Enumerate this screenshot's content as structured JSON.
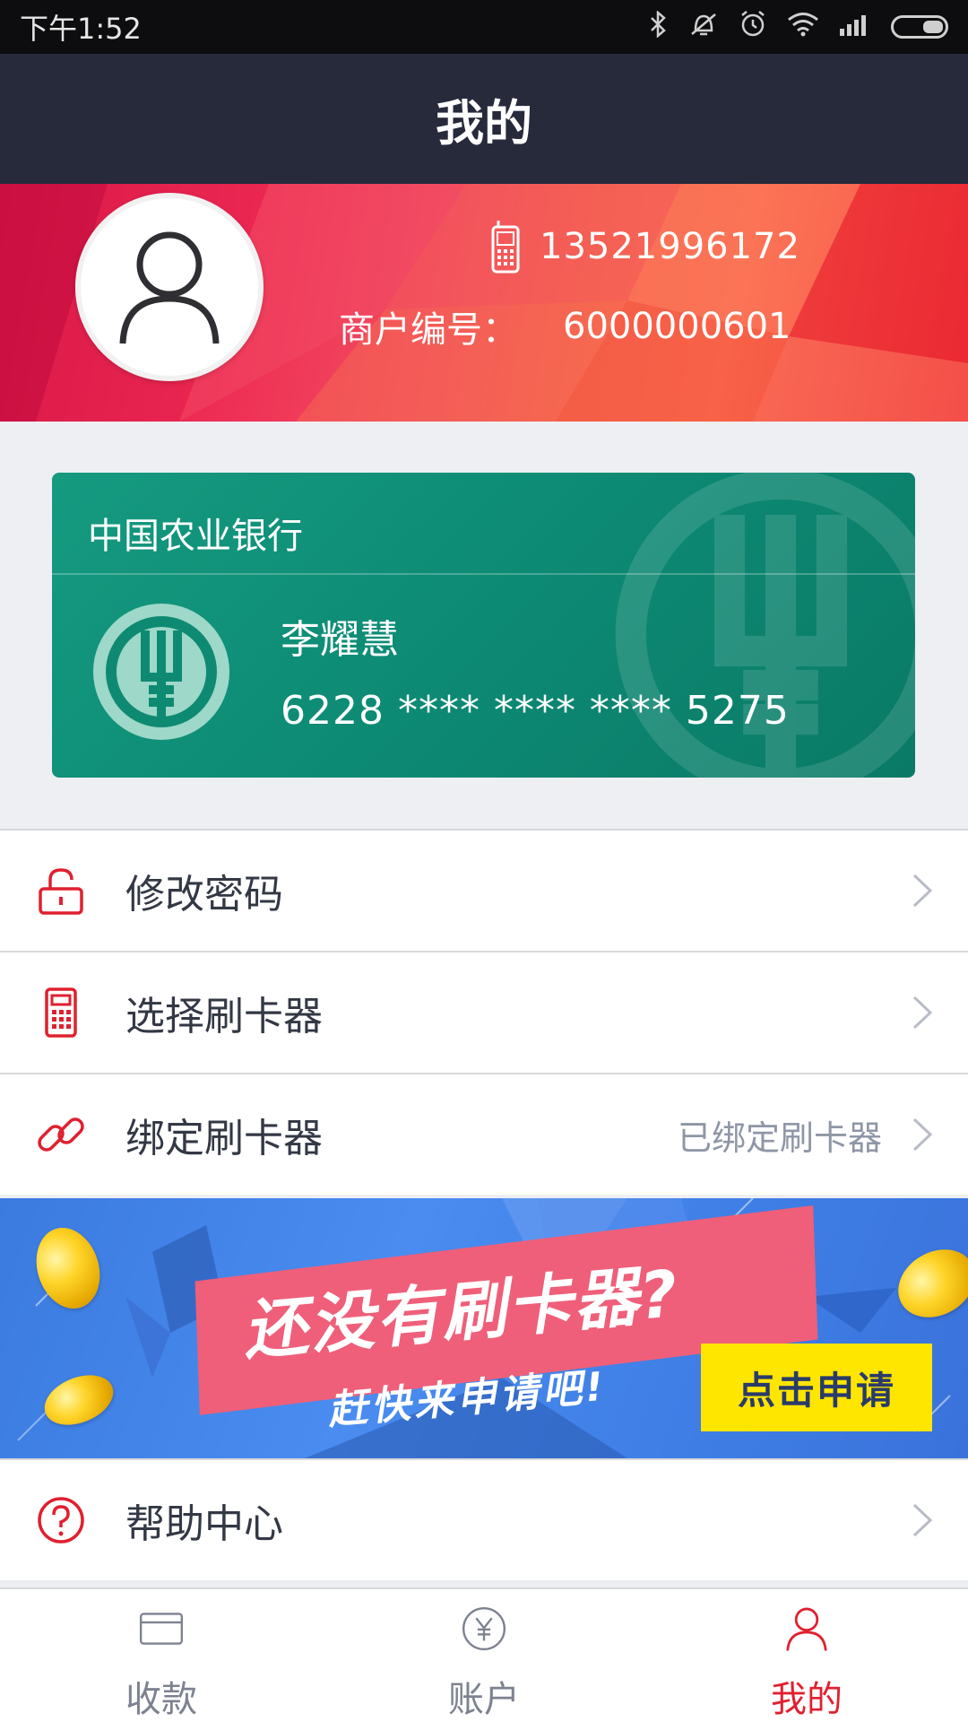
{
  "status_bar": {
    "time": "下午1:52",
    "icons": [
      "bluetooth-icon",
      "vibrate-off-icon",
      "alarm-icon",
      "wifi-icon",
      "signal-icon",
      "battery-icon"
    ]
  },
  "header": {
    "title": "我的"
  },
  "profile": {
    "phone": "13521996172",
    "merchant_label": "商户编号：",
    "merchant_id": "6000000601"
  },
  "bank_card": {
    "bank_name": "中国农业银行",
    "holder": "李耀慧",
    "card_number": "6228 **** **** **** 5275",
    "color": "#118c75"
  },
  "menu": [
    {
      "label": "修改密码",
      "value": "",
      "icon": "lock-icon"
    },
    {
      "label": "选择刷卡器",
      "value": "",
      "icon": "card-reader-icon"
    },
    {
      "label": "绑定刷卡器",
      "value": "已绑定刷卡器",
      "icon": "link-icon"
    }
  ],
  "banner": {
    "headline": "还没有刷卡器?",
    "subline": "赶快来申请吧!",
    "cta": "点击申请"
  },
  "help": {
    "label": "帮助中心",
    "icon": "help-icon"
  },
  "bottom_nav": [
    {
      "label": "收款",
      "icon": "card-icon",
      "active": false
    },
    {
      "label": "账户",
      "icon": "yen-icon",
      "active": false
    },
    {
      "label": "我的",
      "icon": "user-icon",
      "active": true
    }
  ],
  "colors": {
    "accent": "#e0202f",
    "header_bg": "#262a3b",
    "banner_cta": "#ffe600"
  }
}
